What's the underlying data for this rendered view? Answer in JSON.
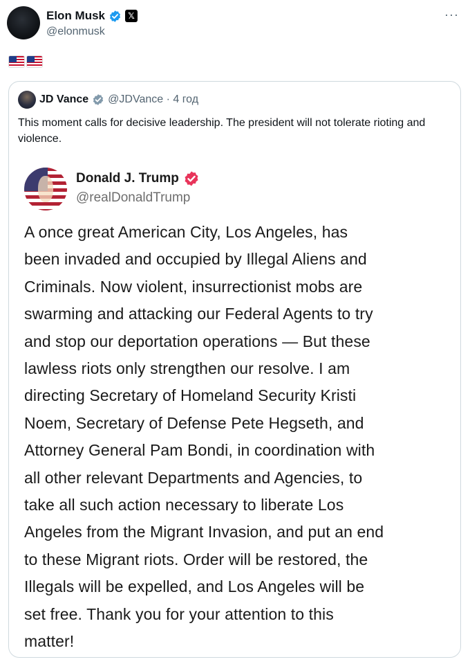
{
  "post": {
    "display_name": "Elon Musk",
    "handle": "@elonmusk",
    "more_label": "···",
    "badge_icon": "verified-badge-icon",
    "affiliation_icon": "x-logo-icon",
    "emoji_text": "🇺🇸🇺🇸"
  },
  "quoted_post": {
    "display_name": "JD Vance",
    "handle_time": "@JDVance · 4 год",
    "text": "This moment calls for decisive leadership. The president will not tolerate rioting and violence."
  },
  "truth_post": {
    "display_name": "Donald J. Trump",
    "handle": "@realDonaldTrump",
    "body": "A once great American City, Los Angeles, has\nbeen invaded and occupied by Illegal Aliens and\nCriminals.  Now violent, insurrectionist mobs are\nswarming and attacking our Federal Agents to try\nand stop our deportation operations — But these\nlawless riots only strengthen our resolve. I am\ndirecting Secretary of Homeland Security Kristi\nNoem, Secretary of Defense Pete Hegseth, and\nAttorney General Pam Bondi, in coordination with\nall other relevant Departments and Agencies, to\ntake all such action necessary to liberate Los\nAngeles from the Migrant Invasion, and put an end\nto these Migrant riots. Order will be restored, the\nIllegals will be expelled, and Los Angeles will be\nset free. Thank you for your attention to this\nmatter!"
  },
  "colors": {
    "verified_blue": "#1d9bf0",
    "truth_badge": "#e8345a",
    "secondary_text": "#536471",
    "border": "#cfd9de"
  }
}
